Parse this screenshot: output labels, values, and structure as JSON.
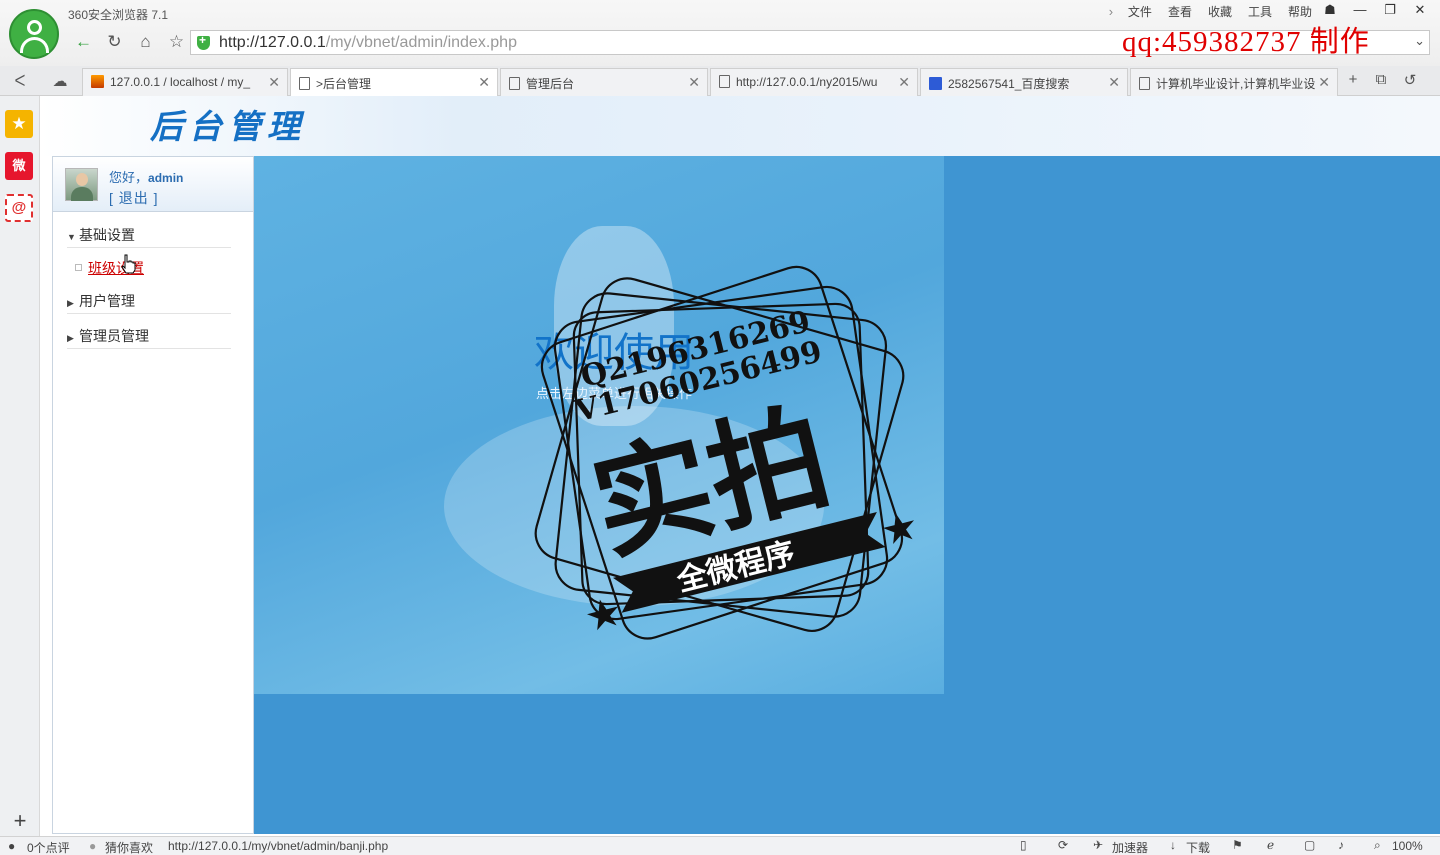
{
  "browser": {
    "app_title": "360安全浏览器 7.1",
    "menu": [
      "文件",
      "查看",
      "收藏",
      "工具",
      "帮助"
    ],
    "url_host": "http://127.0.0.1",
    "url_path": "/my/vbnet/admin/index.php",
    "overlay_watermark": "qq:459382737  制作",
    "tabs": [
      {
        "label": "127.0.0.1 / localhost / my_",
        "icon": "phpmyadmin-icon",
        "active": false
      },
      {
        "label": ">后台管理",
        "icon": "page-icon",
        "active": true
      },
      {
        "label": "管理后台",
        "icon": "page-icon",
        "active": false
      },
      {
        "label": "http://127.0.0.1/ny2015/wu",
        "icon": "page-icon",
        "active": false
      },
      {
        "label": "2582567541_百度搜索",
        "icon": "baidu-icon",
        "active": false
      },
      {
        "label": "计算机毕业设计,计算机毕业设",
        "icon": "page-icon",
        "active": false
      }
    ],
    "status": {
      "comments": "0个点评",
      "guess": "猜你喜欢",
      "link": "http://127.0.0.1/my/vbnet/admin/banji.php",
      "accelerator": "加速器",
      "download": "下载",
      "zoom": "100%"
    }
  },
  "page": {
    "header_title": "后台管理",
    "greeting": "您好，",
    "username": "admin",
    "logout": "[ 退出 ]",
    "menu": {
      "basic": "基础设置",
      "class_settings": "班级设置",
      "users": "用户管理",
      "admins": "管理员管理"
    },
    "welcome": "欢迎使用",
    "welcome_sub": "点击左边菜单进行相关操作"
  },
  "stamp": {
    "line1": "Q2196316269",
    "line2": "V17060256499",
    "big": "实拍",
    "banner": "全微程序"
  }
}
